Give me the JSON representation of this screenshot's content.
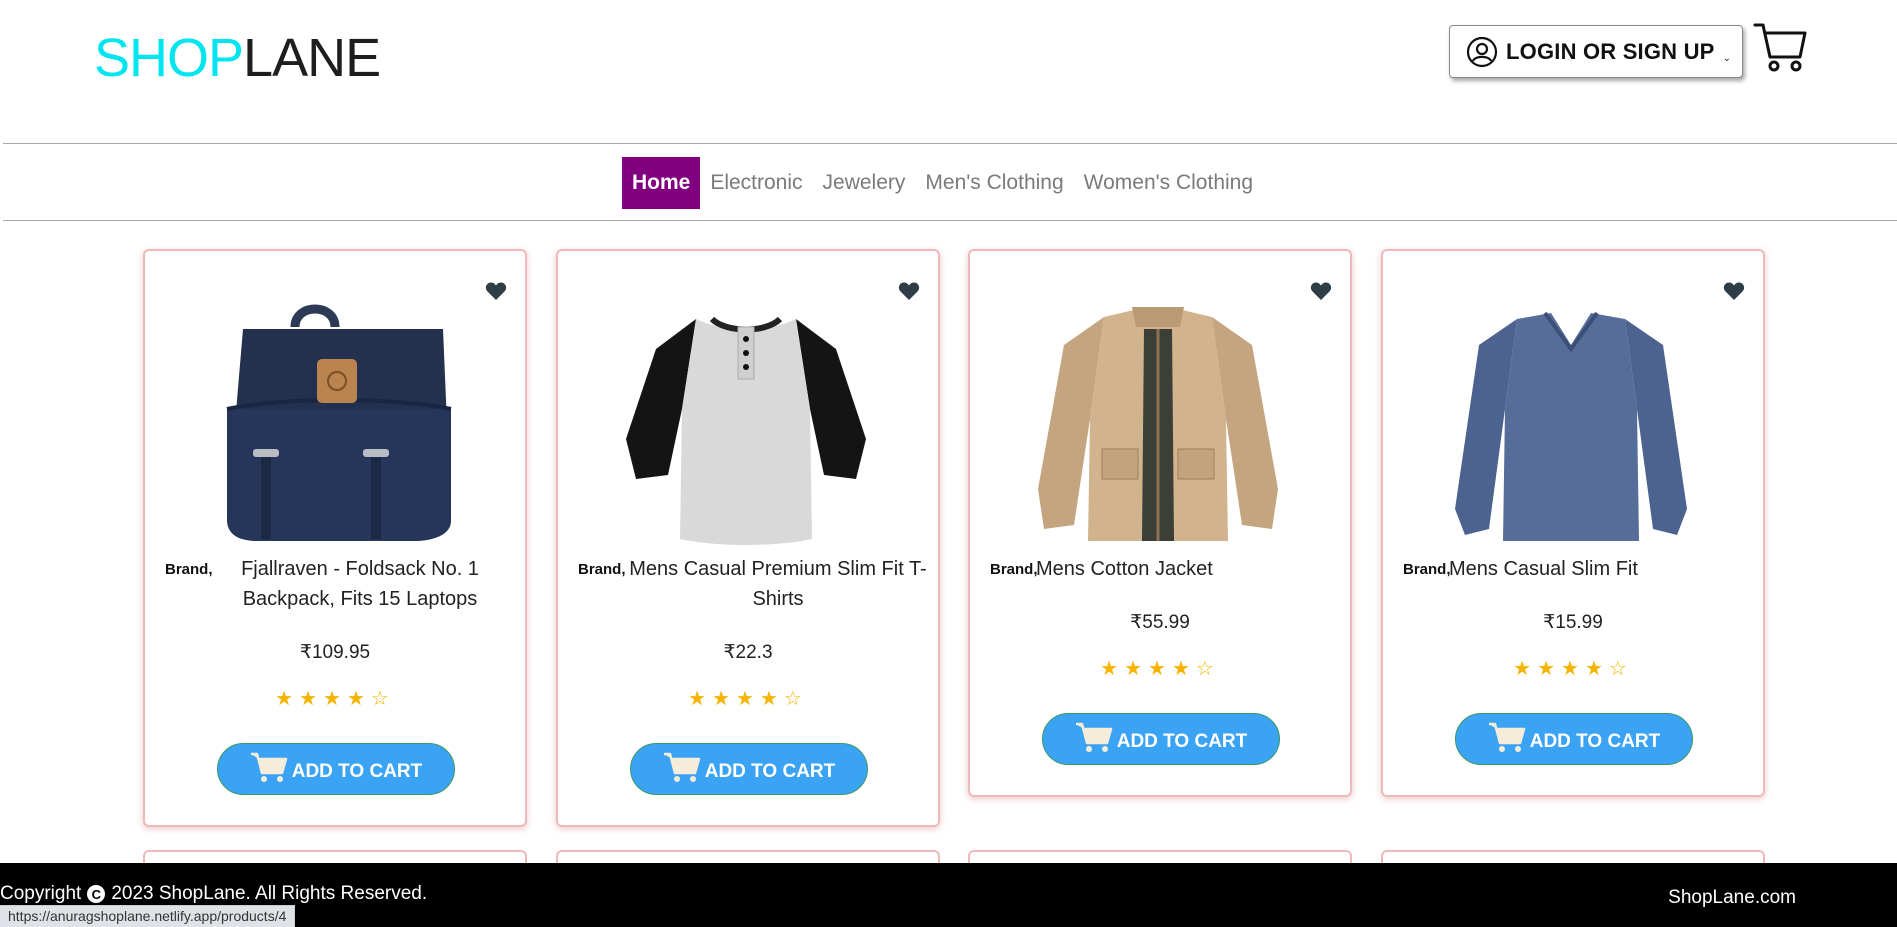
{
  "header": {
    "logo_part1": "SHOP",
    "logo_part2": "LANE",
    "login_label": "LOGIN OR SIGN UP",
    "caret_glyph": "⌄",
    "cart_icon": "cart-icon"
  },
  "nav": {
    "items": [
      {
        "label": "Home",
        "active": true
      },
      {
        "label": "Electronic",
        "active": false
      },
      {
        "label": "Jewelery",
        "active": false
      },
      {
        "label": "Men's Clothing",
        "active": false
      },
      {
        "label": "Women's Clothing",
        "active": false
      }
    ]
  },
  "products": [
    {
      "brand": "Brand,",
      "title": "Fjallraven - Foldsack No. 1 Backpack, Fits 15 Laptops",
      "price": "₹109.95",
      "rating_stars": 4,
      "stars": "★★★★☆",
      "button": "ADD TO CART",
      "image": "backpack"
    },
    {
      "brand": "Brand,",
      "title": "Mens Casual Premium Slim Fit T-Shirts",
      "price": "₹22.3",
      "rating_stars": 4,
      "stars": "★★★★☆",
      "button": "ADD TO CART",
      "image": "raglan-tshirt"
    },
    {
      "brand": "Brand,",
      "title": "Mens Cotton Jacket",
      "price": "₹55.99",
      "rating_stars": 4,
      "stars": "★★★★☆",
      "button": "ADD TO CART",
      "image": "cotton-jacket"
    },
    {
      "brand": "Brand,",
      "title": "Mens Casual Slim Fit",
      "price": "₹15.99",
      "rating_stars": 4,
      "stars": "★★★★☆",
      "button": "ADD TO CART",
      "image": "long-sleeve-shirt"
    }
  ],
  "footer": {
    "copyright_prefix": "Copyright",
    "copyright_symbol": "C",
    "copyright_text": "2023 ShopLane. All Rights Reserved.",
    "site": "ShopLane.com"
  },
  "status_url": "https://anuragshoplane.netlify.app/products/4",
  "colors": {
    "logo_accent": "#00e5ef",
    "nav_active": "#800080",
    "add_to_cart": "#3ba3f3",
    "star": "#f5b400",
    "card_border": "#efb9b9"
  }
}
